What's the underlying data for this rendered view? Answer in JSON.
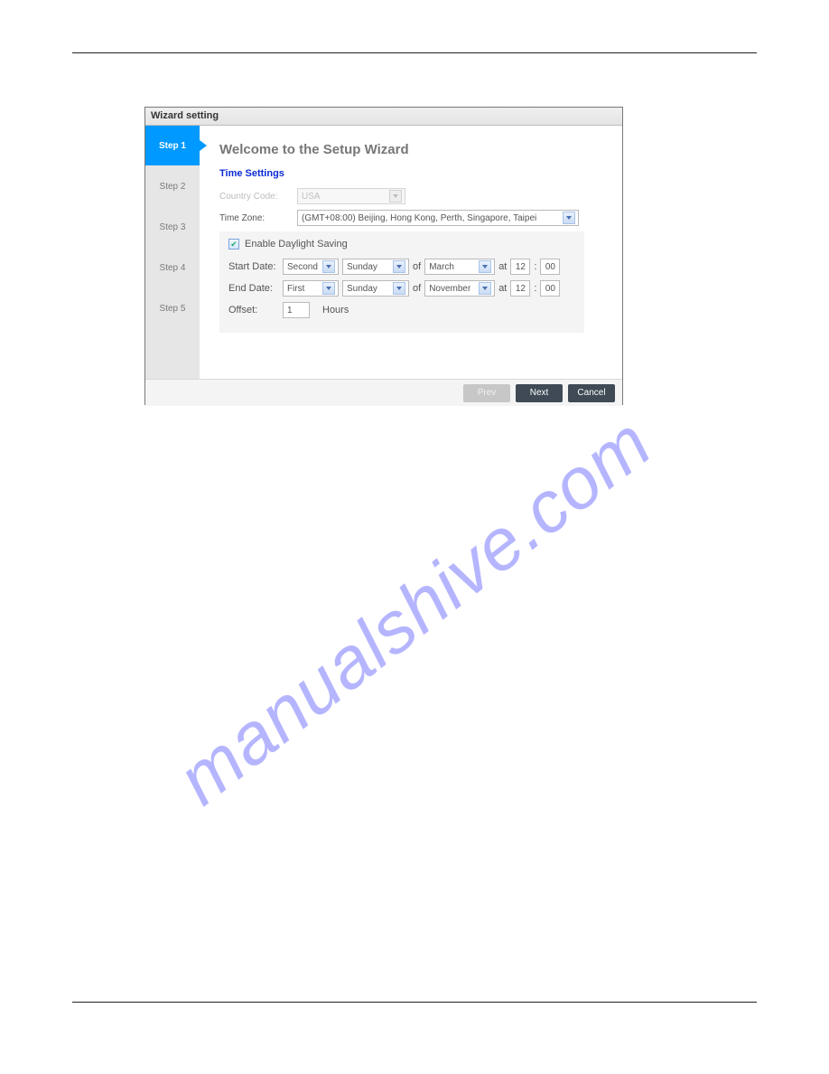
{
  "watermark": "manualshive.com",
  "wizard": {
    "title": "Wizard setting",
    "steps": [
      "Step 1",
      "Step 2",
      "Step 3",
      "Step 4",
      "Step 5"
    ],
    "activeStep": 0,
    "heading": "Welcome to the Setup Wizard",
    "sectionTitle": "Time Settings",
    "countryCode": {
      "label": "Country Code:",
      "value": "USA"
    },
    "timeZone": {
      "label": "Time Zone:",
      "value": "(GMT+08:00) Beijing, Hong Kong, Perth, Singapore, Taipei"
    },
    "dst": {
      "enableLabel": "Enable Daylight Saving",
      "checked": true,
      "startLabel": "Start Date:",
      "endLabel": "End Date:",
      "ofText": "of",
      "atText": "at",
      "colon": ":",
      "start": {
        "week": "Second",
        "day": "Sunday",
        "month": "March",
        "hour": "12",
        "min": "00"
      },
      "end": {
        "week": "First",
        "day": "Sunday",
        "month": "November",
        "hour": "12",
        "min": "00"
      },
      "offsetLabel": "Offset:",
      "offsetValue": "1",
      "offsetUnit": "Hours"
    },
    "buttons": {
      "prev": "Prev",
      "next": "Next",
      "cancel": "Cancel"
    }
  }
}
